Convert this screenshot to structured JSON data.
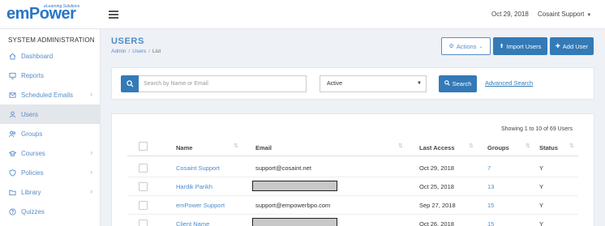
{
  "header": {
    "logo_text": "emPower",
    "logo_tagline": "eLearning Solutions",
    "date": "Oct 29, 2018",
    "user": "Cosaint Support"
  },
  "sidebar": {
    "title": "SYSTEM ADMINISTRATION",
    "items": [
      {
        "label": "Dashboard",
        "icon": "home-icon",
        "chevron": false,
        "active": false
      },
      {
        "label": "Reports",
        "icon": "monitor-icon",
        "chevron": false,
        "active": false
      },
      {
        "label": "Scheduled Emails",
        "icon": "envelope-icon",
        "chevron": true,
        "active": false
      },
      {
        "label": "Users",
        "icon": "user-icon",
        "chevron": false,
        "active": true
      },
      {
        "label": "Groups",
        "icon": "users-icon",
        "chevron": false,
        "active": false
      },
      {
        "label": "Courses",
        "icon": "graduation-cap-icon",
        "chevron": true,
        "active": false
      },
      {
        "label": "Policies",
        "icon": "shield-icon",
        "chevron": true,
        "active": false
      },
      {
        "label": "Library",
        "icon": "folder-icon",
        "chevron": true,
        "active": false
      },
      {
        "label": "Quizzes",
        "icon": "quiz-icon",
        "chevron": false,
        "active": false
      }
    ]
  },
  "page": {
    "title": "USERS",
    "breadcrumb": [
      "Admin",
      "Users",
      "List"
    ],
    "breadcrumb_sep": "/"
  },
  "toolbar": {
    "actions_label": "Actions",
    "import_label": "Import Users",
    "add_label": "Add User"
  },
  "filter": {
    "search_placeholder": "Search by Name or Email",
    "status_value": "Active",
    "search_button": "Search",
    "advanced_link": "Advanced Search"
  },
  "table": {
    "showing_text": "Showing 1 to 10 of 69 Users",
    "columns": [
      "Name",
      "Email",
      "Last Access",
      "Groups",
      "Status"
    ],
    "rows": [
      {
        "name": "Cosaint Support",
        "email": "support@cosaint.net",
        "email_redacted": false,
        "last_access": "Oct 29, 2018",
        "groups": "7",
        "status": "Y"
      },
      {
        "name": "Hardik Parikh",
        "email": "",
        "email_redacted": true,
        "last_access": "Oct 25, 2018",
        "groups": "13",
        "status": "Y"
      },
      {
        "name": "emPower Support",
        "email": "support@empowerbpo.com",
        "email_redacted": false,
        "last_access": "Sep 27, 2018",
        "groups": "15",
        "status": "Y"
      },
      {
        "name": "Client Name",
        "email": "",
        "email_redacted": true,
        "last_access": "Oct 26, 2018",
        "groups": "15",
        "status": "Y"
      }
    ]
  },
  "colors": {
    "primary": "#337ab7",
    "link": "#4d8bcb",
    "sidebar_active": "#e3e6ea"
  }
}
